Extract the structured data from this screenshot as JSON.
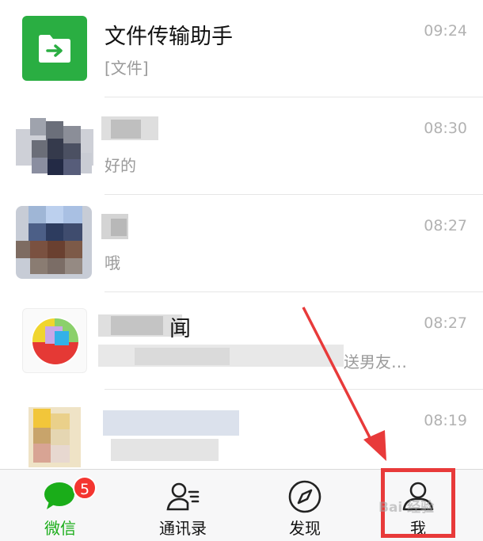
{
  "chats": [
    {
      "name": "文件传输助手",
      "preview": "[文件]",
      "time": "09:24",
      "avatar_icon": "folder-arrow-icon"
    },
    {
      "name": "",
      "preview": "好的",
      "time": "08:30"
    },
    {
      "name": "",
      "preview": "哦",
      "time": "08:27"
    },
    {
      "name": "闻",
      "preview": "送男友…",
      "time": "08:27"
    },
    {
      "name": "",
      "preview": "",
      "time": "08:19"
    }
  ],
  "tabbar": {
    "tabs": [
      {
        "label": "微信",
        "icon": "chat-bubble-icon",
        "badge": "5",
        "active": true
      },
      {
        "label": "通讯录",
        "icon": "contacts-icon"
      },
      {
        "label": "发现",
        "icon": "compass-icon"
      },
      {
        "label": "我",
        "icon": "person-icon"
      }
    ]
  },
  "colors": {
    "accent": "#1aad19",
    "badge": "#f43530",
    "annotation": "#e83a3a"
  },
  "watermark": "Bai 经验"
}
